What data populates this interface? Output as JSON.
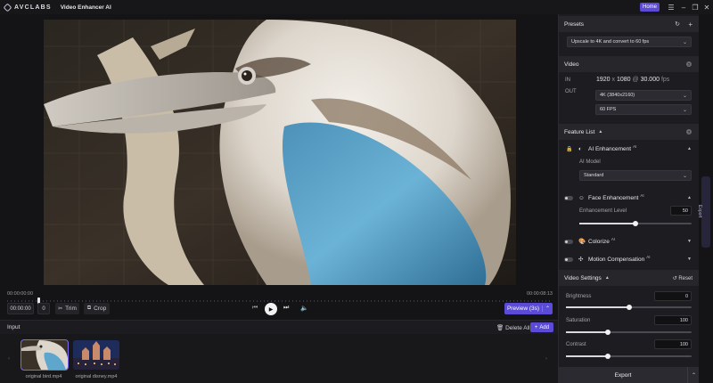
{
  "titlebar": {
    "brand": "AVCLABS",
    "app_title": "Video Enhancer AI",
    "home_label": "Home",
    "icons": [
      "menu-icon",
      "minimize-icon",
      "restore-icon",
      "close-icon"
    ]
  },
  "player": {
    "time_start": "00:00:00:00",
    "time_end": "00:00:08:13",
    "progress": 0.055,
    "current_time": "00:00:00",
    "frame": "0",
    "trim_label": "Trim",
    "crop_label": "Crop",
    "preview_label": "Preview (3s)"
  },
  "input": {
    "title": "Input",
    "delete_all_label": "Delete All",
    "add_label": "Add",
    "files": [
      {
        "name": "original bird.mp4",
        "selected": true
      },
      {
        "name": "original disney.mp4",
        "selected": false
      }
    ]
  },
  "presets": {
    "title": "Presets",
    "selected": "Upscale to 4K and convert to 60 fps"
  },
  "video": {
    "title": "Video",
    "in_label": "IN",
    "out_label": "OUT",
    "in_width": "1920",
    "in_x": "x",
    "in_height": "1080",
    "in_at": "@",
    "in_fps": "30.000",
    "in_fps_unit": "fps",
    "out_resolution": "4K (3840x2160)",
    "out_fps": "60 FPS"
  },
  "features": {
    "title": "Feature List",
    "ai_enhancement": {
      "label": "AI Enhancement",
      "badge": "AI",
      "model_label": "AI Model",
      "model_value": "Standard"
    },
    "face_enhancement": {
      "label": "Face Enhancement",
      "badge": "AI",
      "level_label": "Enhancement Level",
      "level_value": "50",
      "level": 50
    },
    "colorize": {
      "label": "Colorize",
      "badge": "AI"
    },
    "motion_compensation": {
      "label": "Motion Compensation",
      "badge": "AI"
    }
  },
  "video_settings": {
    "title": "Video Settings",
    "reset_label": "Reset",
    "brightness": {
      "label": "Brightness",
      "value": "0",
      "level": 0.5
    },
    "saturation": {
      "label": "Saturation",
      "value": "100",
      "level": 0.33
    },
    "contrast": {
      "label": "Contrast",
      "value": "100",
      "level": 0.33
    }
  },
  "export": {
    "label": "Export",
    "side_tab": "Export"
  },
  "colors": {
    "accent": "#5b4bd6",
    "background": "#141416",
    "panel": "#1d1d21"
  }
}
